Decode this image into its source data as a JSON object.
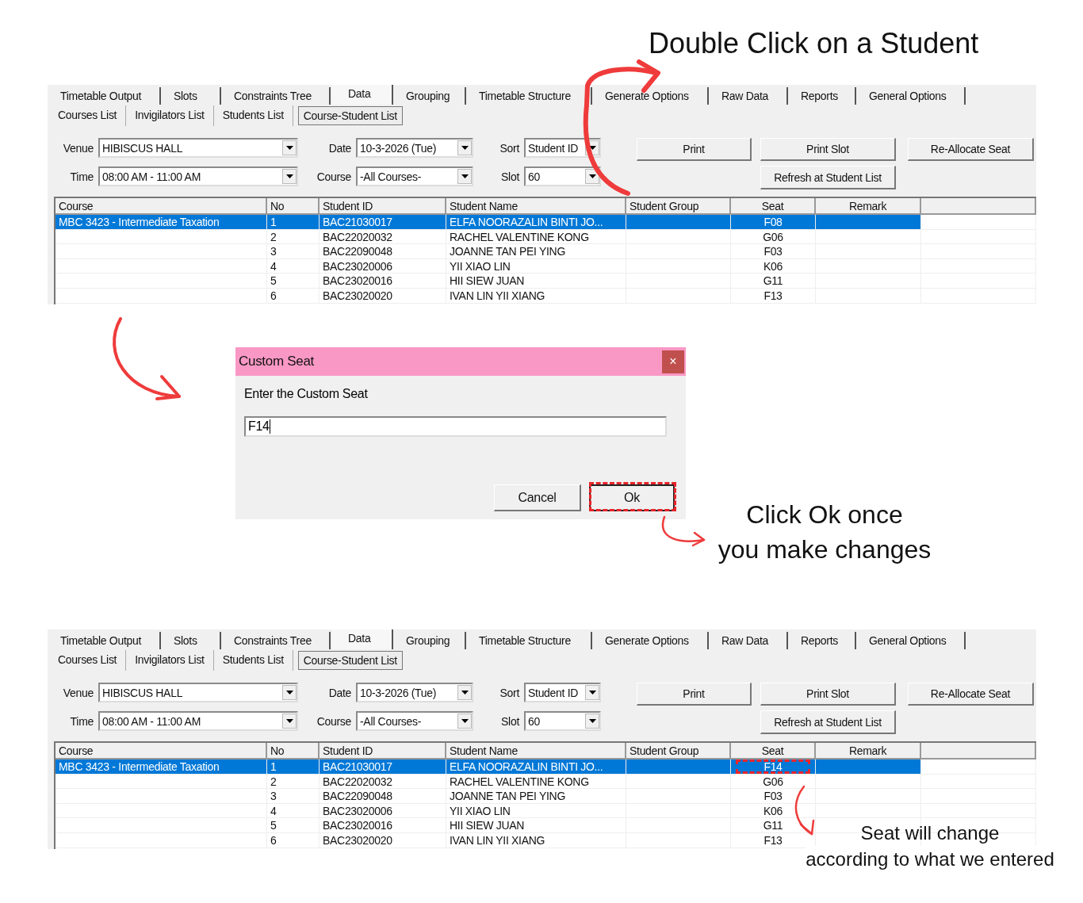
{
  "title": "Double Click on a Student",
  "panels": [
    {
      "tabs": [
        {
          "label": "Timetable Output",
          "selected": false
        },
        {
          "label": "Slots",
          "selected": false
        },
        {
          "label": "Constraints Tree",
          "selected": false
        },
        {
          "label": "Data",
          "selected": true
        },
        {
          "label": "Grouping",
          "selected": false
        },
        {
          "label": "Timetable Structure",
          "selected": false
        },
        {
          "label": "Generate Options",
          "selected": false
        },
        {
          "label": "Raw Data",
          "selected": false
        },
        {
          "label": "Reports",
          "selected": false
        },
        {
          "label": "General Options",
          "selected": false
        }
      ],
      "subtabs": [
        {
          "label": "Courses List",
          "selected": false
        },
        {
          "label": "Invigilators List",
          "selected": false
        },
        {
          "label": "Students List",
          "selected": false
        },
        {
          "label": "Course-Student List",
          "selected": true
        }
      ],
      "filter_rows": [
        [
          {
            "label": "Venue",
            "value": "HIBISCUS HALL"
          },
          {
            "label": "Date",
            "value": "10-3-2026 (Tue)"
          },
          {
            "label": "Sort",
            "value": "Student ID"
          }
        ],
        [
          {
            "label": "Time",
            "value": "08:00 AM - 11:00 AM"
          },
          {
            "label": "Course",
            "value": "-All Courses-"
          },
          {
            "label": "Slot",
            "value": "60"
          }
        ]
      ],
      "buttons": [
        "Print",
        "Print Slot",
        "Re-Allocate Seat",
        "Refresh at Student List"
      ],
      "columns": [
        "Course",
        "No",
        "Student ID",
        "Student Name",
        "Student Group",
        "Seat",
        "Remark"
      ],
      "rows": [
        {
          "course": "MBC 3423 - Intermediate Taxation",
          "no": "1",
          "student_id": "BAC21030017",
          "student_name": "ELFA NOORAZALIN BINTI JO...",
          "seat": "F08",
          "selected": true,
          "seat_marked": false
        },
        {
          "no": "2",
          "student_id": "BAC22020032",
          "student_name": "RACHEL VALENTINE KONG",
          "seat": "G06",
          "selected": false,
          "seat_marked": false
        },
        {
          "no": "3",
          "student_id": "BAC22090048",
          "student_name": "JOANNE TAN PEI YING",
          "seat": "F03",
          "selected": false,
          "seat_marked": false
        },
        {
          "no": "4",
          "student_id": "BAC23020006",
          "student_name": "YII XIAO LIN",
          "seat": "K06",
          "selected": false,
          "seat_marked": false
        },
        {
          "no": "5",
          "student_id": "BAC23020016",
          "student_name": "HII SIEW JUAN",
          "seat": "G11",
          "selected": false,
          "seat_marked": false
        },
        {
          "no": "6",
          "student_id": "BAC23020020",
          "student_name": "IVAN LIN YII XIANG",
          "seat": "F13",
          "selected": false,
          "seat_marked": false
        }
      ]
    },
    {
      "tabs": [
        {
          "label": "Timetable Output",
          "selected": false
        },
        {
          "label": "Slots",
          "selected": false
        },
        {
          "label": "Constraints Tree",
          "selected": false
        },
        {
          "label": "Data",
          "selected": true
        },
        {
          "label": "Grouping",
          "selected": false
        },
        {
          "label": "Timetable Structure",
          "selected": false
        },
        {
          "label": "Generate Options",
          "selected": false
        },
        {
          "label": "Raw Data",
          "selected": false
        },
        {
          "label": "Reports",
          "selected": false
        },
        {
          "label": "General Options",
          "selected": false
        }
      ],
      "subtabs": [
        {
          "label": "Courses List",
          "selected": false
        },
        {
          "label": "Invigilators List",
          "selected": false
        },
        {
          "label": "Students List",
          "selected": false
        },
        {
          "label": "Course-Student List",
          "selected": true
        }
      ],
      "filter_rows": [
        [
          {
            "label": "Venue",
            "value": "HIBISCUS HALL"
          },
          {
            "label": "Date",
            "value": "10-3-2026 (Tue)"
          },
          {
            "label": "Sort",
            "value": "Student ID"
          }
        ],
        [
          {
            "label": "Time",
            "value": "08:00 AM - 11:00 AM"
          },
          {
            "label": "Course",
            "value": "-All Courses-"
          },
          {
            "label": "Slot",
            "value": "60"
          }
        ]
      ],
      "buttons": [
        "Print",
        "Print Slot",
        "Re-Allocate Seat",
        "Refresh at Student List"
      ],
      "columns": [
        "Course",
        "No",
        "Student ID",
        "Student Name",
        "Student Group",
        "Seat",
        "Remark"
      ],
      "rows": [
        {
          "course": "MBC 3423 - Intermediate Taxation",
          "no": "1",
          "student_id": "BAC21030017",
          "student_name": "ELFA NOORAZALIN BINTI JO...",
          "seat": "F14",
          "selected": true,
          "seat_marked": true
        },
        {
          "no": "2",
          "student_id": "BAC22020032",
          "student_name": "RACHEL VALENTINE KONG",
          "seat": "G06",
          "selected": false,
          "seat_marked": false
        },
        {
          "no": "3",
          "student_id": "BAC22090048",
          "student_name": "JOANNE TAN PEI YING",
          "seat": "F03",
          "selected": false,
          "seat_marked": false
        },
        {
          "no": "4",
          "student_id": "BAC23020006",
          "student_name": "YII XIAO LIN",
          "seat": "K06",
          "selected": false,
          "seat_marked": false
        },
        {
          "no": "5",
          "student_id": "BAC23020016",
          "student_name": "HII SIEW JUAN",
          "seat": "G11",
          "selected": false,
          "seat_marked": false
        },
        {
          "no": "6",
          "student_id": "BAC23020020",
          "student_name": "IVAN LIN YII XIANG",
          "seat": "F13",
          "selected": false,
          "seat_marked": false
        }
      ]
    }
  ],
  "dialog": {
    "title": "Custom Seat",
    "close": "×",
    "prompt": "Enter the Custom Seat",
    "value": "F14",
    "buttons": [
      {
        "label": "Cancel",
        "marked": false
      },
      {
        "label": "Ok",
        "marked": true
      }
    ]
  },
  "ok_note": [
    "Click Ok once",
    "you make changes"
  ],
  "seat_note": [
    "Seat will change",
    "according to what we entered"
  ]
}
